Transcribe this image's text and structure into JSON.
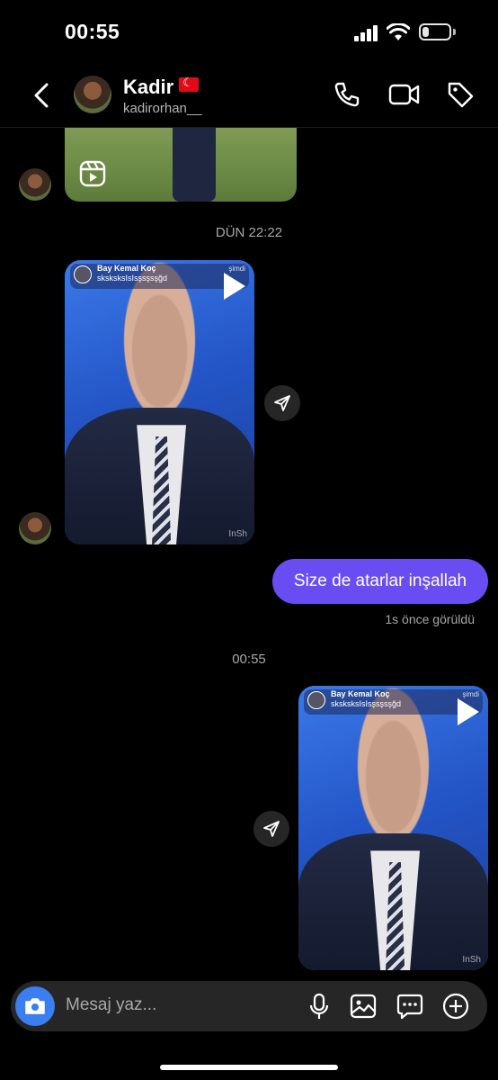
{
  "status_bar": {
    "time": "00:55"
  },
  "header": {
    "name": "Kadir",
    "username": "kadirorhan__",
    "icons": [
      "back-arrow-icon",
      "phone-icon",
      "video-icon",
      "tag-icon"
    ]
  },
  "thread": {
    "timestamps": [
      "DÜN 22:22",
      "00:55"
    ],
    "shared_post": {
      "author": "Bay Kemal Koç",
      "caption": "sksksksIsIsşsşsşğd",
      "time": "şimdi",
      "watermark": "InSh"
    },
    "sent_message": "Size de atarlar inşallah",
    "seen_text": "1s önce görüldü"
  },
  "composer": {
    "placeholder": "Mesaj yaz...",
    "icons": [
      "camera-icon",
      "microphone-icon",
      "gallery-icon",
      "sticker-icon",
      "plus-icon"
    ]
  },
  "colors": {
    "accent_bubble": "#6a4cf3",
    "camera_button": "#3a7ef0",
    "background": "#000000"
  }
}
